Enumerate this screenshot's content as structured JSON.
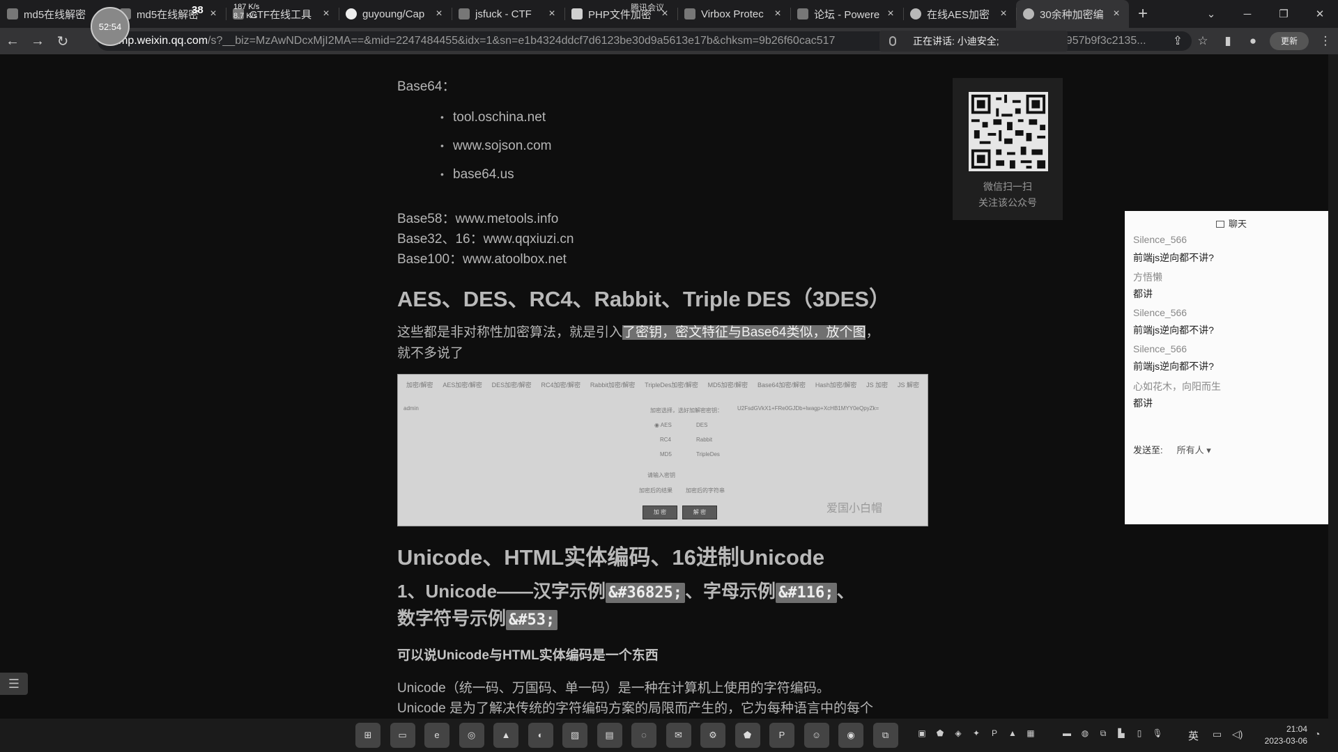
{
  "browser": {
    "tabs": [
      {
        "label": "md5在线解密",
        "icon": "page-icon"
      },
      {
        "label": "md5在线解密",
        "icon": "page-icon"
      },
      {
        "label": "CTF在线工具",
        "icon": "page-icon"
      },
      {
        "label": "guyoung/Cap",
        "icon": "github-icon"
      },
      {
        "label": "jsfuck - CTF",
        "icon": "page-icon"
      },
      {
        "label": "PHP文件加密",
        "icon": "doc-icon"
      },
      {
        "label": "Virbox Protec",
        "icon": "page-icon"
      },
      {
        "label": "论坛 - Powere",
        "icon": "page-icon"
      },
      {
        "label": "在线AES加密",
        "icon": "globe-icon"
      },
      {
        "label": "30余种加密编",
        "icon": "gear-icon",
        "active": true
      }
    ],
    "overlay": {
      "timer": "52:54",
      "cpu": "38",
      "net_up": "187 K/s",
      "net_down": "8.7 K/s",
      "meeting": "腾讯会议"
    },
    "url_host": "mp.weixin.qq.com",
    "url_rest": "/s?__biz=MzAwNDcxMjI2MA==&mid=2247484455&idx=1&sn=e1b4324ddcf7d6123be30d9a5613e17b&chksm=9b26f60cac517",
    "url_tail": "47957b9f3c2135...",
    "speaking": "正在讲话: 小迪安全;",
    "update_label": "更新"
  },
  "article": {
    "base64_label": "Base64：",
    "base64_sites": [
      "tool.oschina.net",
      "www.sojson.com",
      "base64.us"
    ],
    "base58": "Base58：www.metools.info",
    "base32": "Base32、16：www.qqxiuzi.cn",
    "base100": "Base100：www.atoolbox.net",
    "h_sym": "AES、DES、RC4、Rabbit、Triple DES（3DES）",
    "p1_a": "这些都是非对称性加密算法，就是引入",
    "p1_hl": "了密钥，密文特征与Base64类似，放个图",
    "p1_b": "，",
    "p1_c": "就不多说了",
    "h_unicode": "Unicode、HTML实体编码、16进制Unicode",
    "h3_a": "1、Unicode——汉字示例",
    "h3_code1": "&#36825;",
    "h3_b": "、字母示例",
    "h3_code2": "&#116;",
    "h3_c": "、",
    "h3_d": "数字符号示例",
    "h3_code3": "&#53;",
    "bold_line": "可以说Unicode与HTML实体编码是一个东西",
    "p2": "Unicode（统一码、万国码、单一码）是一种在计算机上使用的字符编码。",
    "p3": "Unicode 是为了解决传统的字符编码方案的局限而产生的，它为每种语言中的每个"
  },
  "screenshot": {
    "nav": [
      "加密/解密",
      "AES加密/解密",
      "DES加密/解密",
      "RC4加密/解密",
      "Rabbit加密/解密",
      "TripleDes加密/解密",
      "MD5加密/解密",
      "Base64加密/解密",
      "Hash加密/解密",
      "JS 加密",
      "JS 解密"
    ],
    "input_text": "admin",
    "heading": "加密选择，选好加解密密钥：",
    "output_text": "U2FsdGVkX1+FRe0GJDb+lwagp+XcHB1MYY0eQpyZk=",
    "options": [
      "AES",
      "DES",
      "RC4",
      "Rabbit",
      "MD5",
      "TripleDes"
    ],
    "key_hint": "请输入密钥",
    "enc_hint": "加密后的结果",
    "dec_hint": "加密后的字符串",
    "btn_encrypt": "加 密",
    "btn_decrypt": "解 密",
    "watermark": "爱国小白帽"
  },
  "qr": {
    "caption1": "微信扫一扫",
    "caption2": "关注该公众号"
  },
  "chat": {
    "title": "聊天",
    "lines": [
      {
        "kind": "user",
        "text": "Silence_566"
      },
      {
        "kind": "msg",
        "text": "前端js逆向都不讲?"
      },
      {
        "kind": "user",
        "text": "方悟懒"
      },
      {
        "kind": "msg",
        "text": "都讲"
      },
      {
        "kind": "user",
        "text": "Silence_566"
      },
      {
        "kind": "msg",
        "text": "前端js逆向都不讲?"
      },
      {
        "kind": "user",
        "text": "Silence_566"
      },
      {
        "kind": "msg",
        "text": "前端js逆向都不讲?"
      },
      {
        "kind": "user",
        "text": "心如花木，向阳而生"
      },
      {
        "kind": "msg",
        "text": "都讲"
      }
    ],
    "send_label": "发送至:",
    "send_to": "所有人 ▾"
  },
  "taskbar": {
    "ime": "英",
    "time": "21:04",
    "date": "2023-03-06"
  }
}
